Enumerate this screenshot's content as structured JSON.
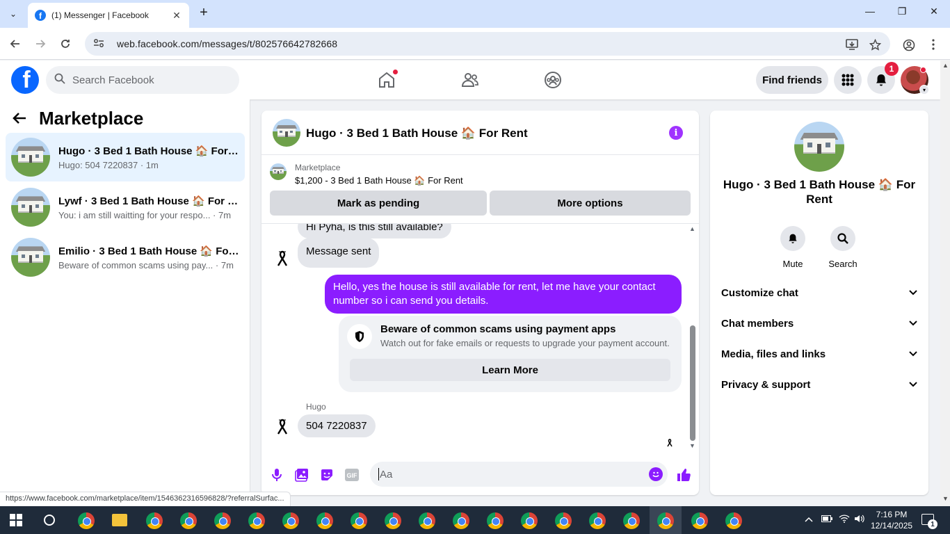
{
  "browser": {
    "tab_title": "(1) Messenger | Facebook",
    "tab_close": "✕",
    "new_tab": "+",
    "url": "web.facebook.com/messages/t/802576642782668",
    "status_url": "https://www.facebook.com/marketplace/item/1546362316596828/?referralSurfac...",
    "window_controls": {
      "minimize": "—",
      "maximize": "❐",
      "close": "✕"
    }
  },
  "fb_header": {
    "logo_letter": "f",
    "search_placeholder": "Search Facebook",
    "find_friends": "Find friends",
    "notification_count": "1"
  },
  "sidebar": {
    "title": "Marketplace",
    "conversations": [
      {
        "name": "Hugo · 3 Bed 1 Bath House 🏠 For ...",
        "preview": "Hugo: 504 7220837 · 1m",
        "active": true
      },
      {
        "name": "Lywf · 3 Bed 1 Bath House 🏠 For R...",
        "preview": "You: i am still waitting for your respo... · 7m",
        "active": false
      },
      {
        "name": "Emilio · 3 Bed 1 Bath House 🏠 For...",
        "preview": "Beware of common scams using pay... · 7m",
        "active": false
      }
    ]
  },
  "chat": {
    "title": "Hugo · 3 Bed 1 Bath House 🏠 For Rent",
    "marketplace_label": "Marketplace",
    "listing": "$1,200 - 3 Bed 1 Bath House 🏠 For Rent",
    "mark_pending": "Mark as pending",
    "more_options": "More options",
    "messages": {
      "partial_top": "Hi Pyha, is this still available?",
      "message_sent": "Message sent",
      "outgoing": "Hello, yes the house is still available for rent, let me have your contact number so i can send you  details.",
      "scam_title": "Beware of common scams using payment apps",
      "scam_desc": "Watch out for fake emails or requests to upgrade your payment account.",
      "learn_more": "Learn More",
      "sender_name": "Hugo",
      "incoming_number": "504 7220837"
    },
    "composer_placeholder": "Aa"
  },
  "info_panel": {
    "name": "Hugo · 3 Bed 1 Bath House 🏠 For Rent",
    "mute": "Mute",
    "search": "Search",
    "sections": [
      "Customize chat",
      "Chat members",
      "Media, files and links",
      "Privacy & support"
    ]
  },
  "taskbar": {
    "time": "7:16 PM",
    "date": "12/14/2025",
    "notification_count": "1"
  },
  "colors": {
    "facebook_blue": "#0866ff",
    "messenger_purple": "#8b1dff",
    "active_conversation": "#e7f3ff",
    "notification_red": "#e41e3f"
  }
}
